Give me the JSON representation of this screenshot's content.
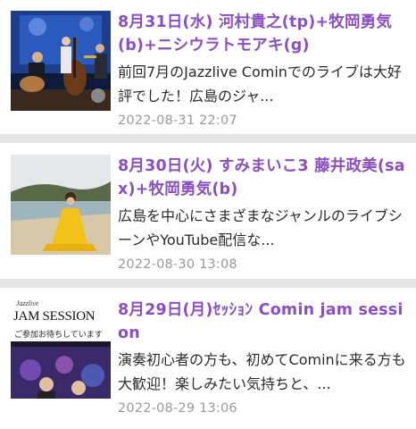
{
  "posts": [
    {
      "title": "8月31日(水) 河村貴之(tp)+牧岡勇気(b)+ニシウラトモアキ(g)",
      "excerpt": "前回7月のJazzlive Cominでのライブは大好評でした！広島のジャ...",
      "date": "2022-08-31 22:07",
      "thumb_icon": "jazz-trio-photo"
    },
    {
      "title": "8月30日(火) すみまいこ3 藤井政美(sax)+牧岡勇気(b)",
      "excerpt": "広島を中心にさまざまなジャンルのライブシーンやYouTube配信な...",
      "date": "2022-08-30 13:08",
      "thumb_icon": "singer-beach-photo"
    },
    {
      "title": "8月29日(月)ｾｯｼｮﾝ Comin jam session",
      "excerpt": "演奏初心者の方も、初めてCominに来る方も大歓迎！楽しみたい気持ちと、...",
      "date": "2022-08-29 13:06",
      "thumb_icon": "jam-session-flyer",
      "thumb_text": {
        "brand": "Jazzlive",
        "heading": "JAM SESSION",
        "sub": "ご参加お待ちしています"
      }
    }
  ]
}
